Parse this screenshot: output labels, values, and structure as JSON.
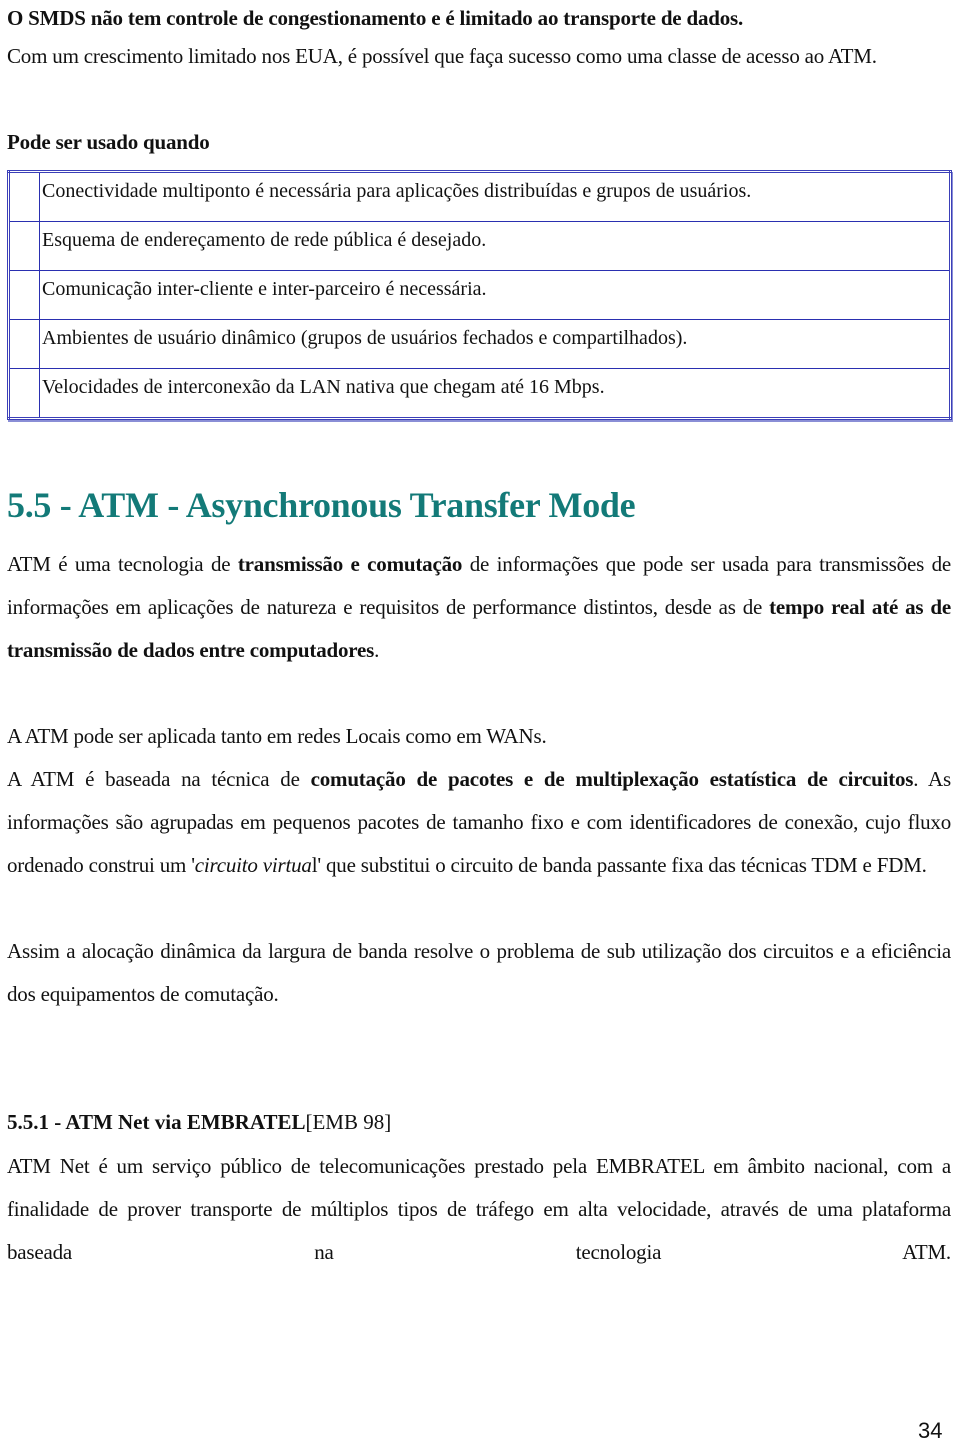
{
  "intro": {
    "line1_bold": "O SMDS não tem controle de congestionamento e é limitado ao transporte de dados.",
    "line2": "Com um crescimento limitado nos EUA, é possível que faça sucesso como uma classe de acesso ao ATM.",
    "lead_bold": "Pode ser usado quando"
  },
  "conditions_table": {
    "rows": [
      "Conectividade multiponto é necessária para aplicações distribuídas e grupos de usuários.",
      "Esquema de endereçamento de rede pública é desejado.",
      "Comunicação inter-cliente e inter-parceiro é necessária.",
      "Ambientes de usuário dinâmico (grupos de usuários fechados e compartilhados).",
      "Velocidades de interconexão da LAN nativa que chegam até 16 Mbps."
    ]
  },
  "section": {
    "title": "5.5 - ATM - Asynchronous Transfer Mode",
    "title_color": "#137a78",
    "p1": {
      "a": "ATM é uma tecnologia de ",
      "b_bold": "transmissão e comutação",
      "c": " de informações que pode ser usada para transmissões de informações em aplicações de natureza e requisitos de performance distintos, desde as de ",
      "d_bold": "tempo real até as de transmissão de dados entre computadores",
      "e": "."
    },
    "p2": "A ATM pode ser aplicada tanto em redes Locais como em WANs.",
    "p3": {
      "a": "A ATM é baseada na técnica de ",
      "b_bold": "comutação de pacotes e de multiplexação estatística de circuitos",
      "c": ". As informações são agrupadas em pequenos pacotes de tamanho fixo e com identificadores de conexão, cujo fluxo ordenado construi um ",
      "d_quote_open": "'",
      "d_italic": "circuito virtua",
      "d_rest": "l'",
      "e": " que substitui o circuito de banda passante fixa das técnicas TDM e FDM."
    },
    "p4": "Assim a alocação dinâmica da largura de banda resolve o problema de sub utilização dos circuitos e a eficiência dos equipamentos de comutação."
  },
  "subsection": {
    "title_bold": "5.5.1 - ATM Net via EMBRATEL",
    "title_ref": "[EMB 98]",
    "p1": "ATM Net é um serviço público de telecomunicações prestado pela EMBRATEL em âmbito nacional, com a finalidade de prover transporte de múltiplos tipos de tráfego em alta velocidade, através de uma plataforma baseada na tecnologia ATM."
  },
  "footer": {
    "page_number": "34"
  }
}
